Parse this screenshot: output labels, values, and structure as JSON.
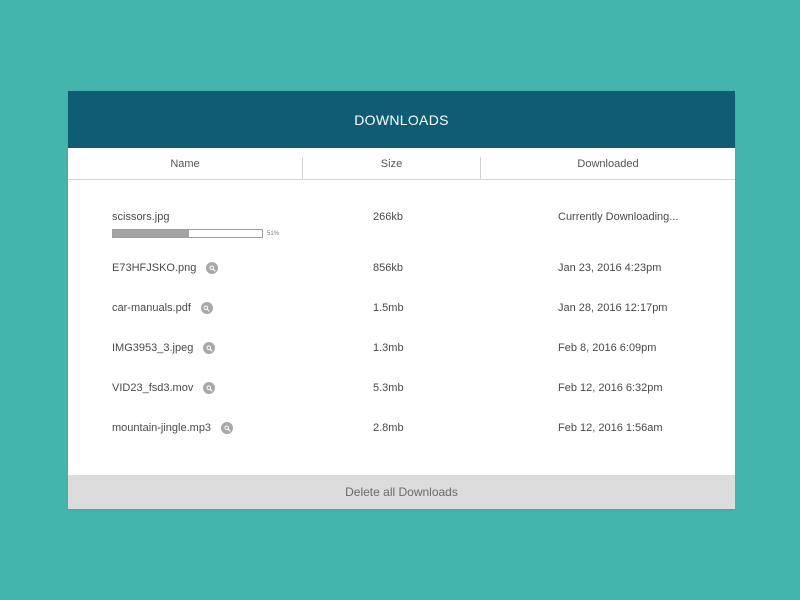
{
  "header": {
    "title": "DOWNLOADS"
  },
  "columns": {
    "name": "Name",
    "size": "Size",
    "downloaded": "Downloaded"
  },
  "rows": [
    {
      "name": "scissors.jpg",
      "size": "266kb",
      "downloaded": "Currently Downloading...",
      "progress_percent": 51,
      "progress_label": "51%"
    },
    {
      "name": "E73HFJSKO.png",
      "size": "856kb",
      "downloaded": "Jan 23, 2016 4:23pm",
      "icon": "search-icon"
    },
    {
      "name": "car-manuals.pdf",
      "size": "1.5mb",
      "downloaded": "Jan 28, 2016 12:17pm",
      "icon": "search-icon"
    },
    {
      "name": "IMG3953_3.jpeg",
      "size": "1.3mb",
      "downloaded": "Feb 8, 2016 6:09pm",
      "icon": "search-icon"
    },
    {
      "name": "VID23_fsd3.mov",
      "size": "5.3mb",
      "downloaded": "Feb 12, 2016 6:32pm",
      "icon": "search-icon"
    },
    {
      "name": "mountain-jingle.mp3",
      "size": "2.8mb",
      "downloaded": "Feb 12, 2016 1:56am",
      "icon": "search-icon"
    }
  ],
  "footer": {
    "delete_label": "Delete all Downloads"
  },
  "colors": {
    "background": "#43b5ad",
    "header": "#0e5d74",
    "progress_fill": "#a3a3a3",
    "footer": "#dcdcdc"
  }
}
